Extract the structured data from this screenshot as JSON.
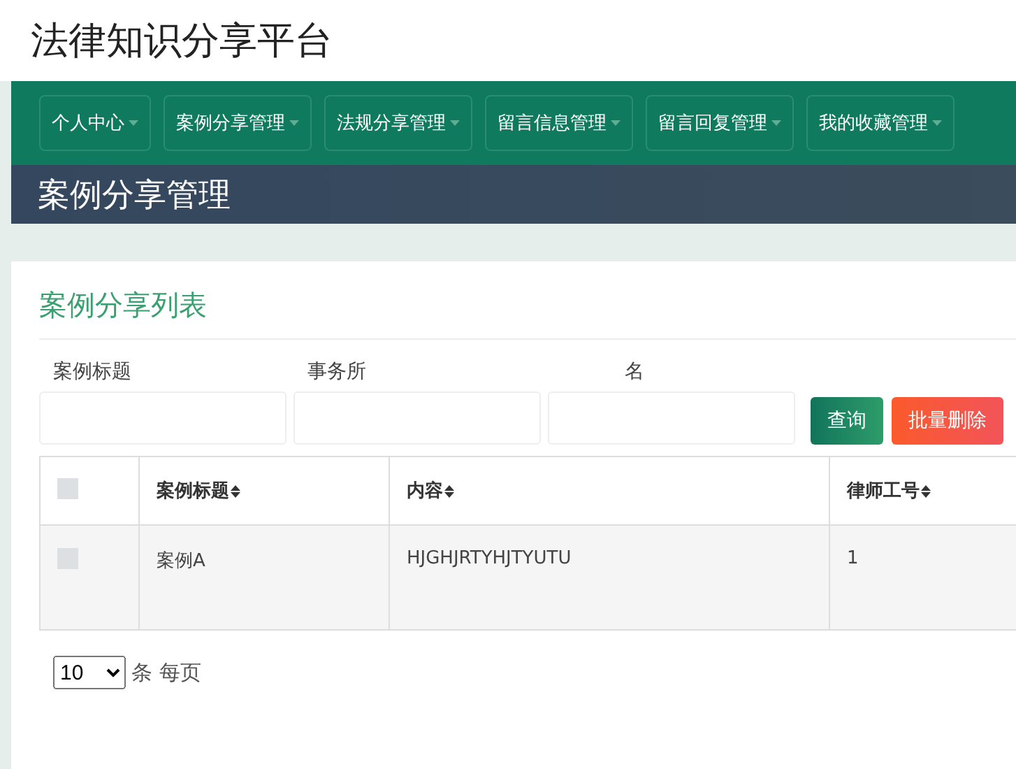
{
  "site_title": "法律知识分享平台",
  "nav": [
    {
      "label": "个人中心"
    },
    {
      "label": "案例分享管理"
    },
    {
      "label": "法规分享管理"
    },
    {
      "label": "留言信息管理"
    },
    {
      "label": "留言回复管理"
    },
    {
      "label": "我的收藏管理"
    }
  ],
  "page_header": "案例分享管理",
  "card_title": "案例分享列表",
  "filters": [
    {
      "label": "案例标题"
    },
    {
      "label": "事务所"
    },
    {
      "label": "名"
    }
  ],
  "buttons": [
    {
      "label": "查询",
      "kind": "primary"
    },
    {
      "label": "批量删除",
      "kind": "danger"
    }
  ],
  "table": {
    "header_checked": false,
    "columns": [
      "案例标题",
      "内容",
      "律师工号"
    ],
    "rows": [
      {
        "checked": false,
        "cells": [
          "案例A",
          "HJGHJRTYHJTYUTU",
          "1"
        ]
      }
    ]
  },
  "page_size": {
    "value": "10",
    "suffix": "条 每页"
  }
}
